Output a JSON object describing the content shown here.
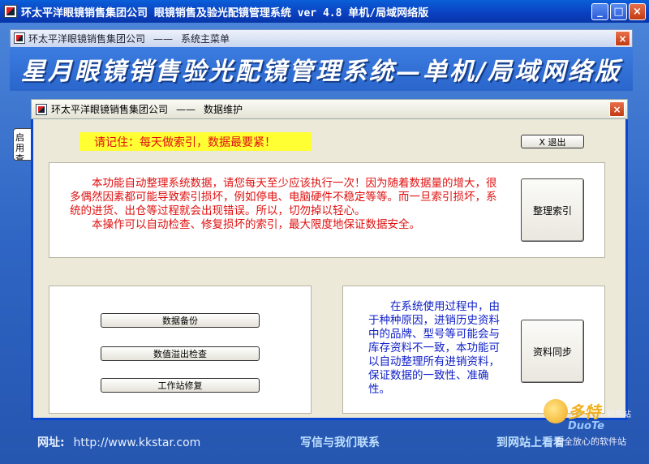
{
  "app": {
    "window_title": "环太平洋眼镜销售集团公司 眼镜销售及验光配镜管理系统 ver 4.8 单机/局域网络版",
    "minimize_glyph": "_",
    "restore_glyph": "□",
    "close_glyph": "×"
  },
  "main_menu": {
    "company": "环太平洋眼镜销售集团公司",
    "separator": "——",
    "title": "系统主菜单",
    "banner": "星月眼镜销售验光配镜管理系统—单机/局域网络版",
    "left_stub": "启用查"
  },
  "dialog": {
    "company": "环太平洋眼镜销售集团公司",
    "separator": "——",
    "title": "数据维护",
    "reminder": "请记住：每天做索引，数据最要紧！",
    "exit_label": "X 退出",
    "top_description": [
      "本功能自动整理系统数据，请您每天至少应该执行一次！因为随着数据量的增大，很多偶然因素都可能导致索引损坏，例如停电、电脑硬件不稳定等等。而一旦索引损坏，系统的进货、出仓等过程就会出现错误。所以，切勿掉以轻心。",
      "本操作可以自动检查、修复损坏的索引，最大限度地保证数据安全。"
    ],
    "reindex_label": "整理索引",
    "left_buttons": [
      "数据备份",
      "数值溢出检查",
      "工作站修复"
    ],
    "right_description": "在系统使用过程中，由于种种原因，进销历史资料中的品牌、型号等可能会与库存资料不一致，本功能可以自动整理所有进销资料，保证数据的一致性、准确性。",
    "sync_label": "资料同步"
  },
  "footer": {
    "site_label": "网址:",
    "site_url": "http://www.kkstar.com",
    "mail_link": "写信与我们联系",
    "visit_link": "到网站上看看"
  },
  "watermark": {
    "big": "多特",
    "small": "软件站",
    "url": "DuoTe",
    "tag": "安全放心的软件站"
  },
  "colors": {
    "accent": "#0a46d0",
    "warning_text": "#e01010",
    "info_text": "#1020c8",
    "reminder_bg": "#ffff33"
  }
}
